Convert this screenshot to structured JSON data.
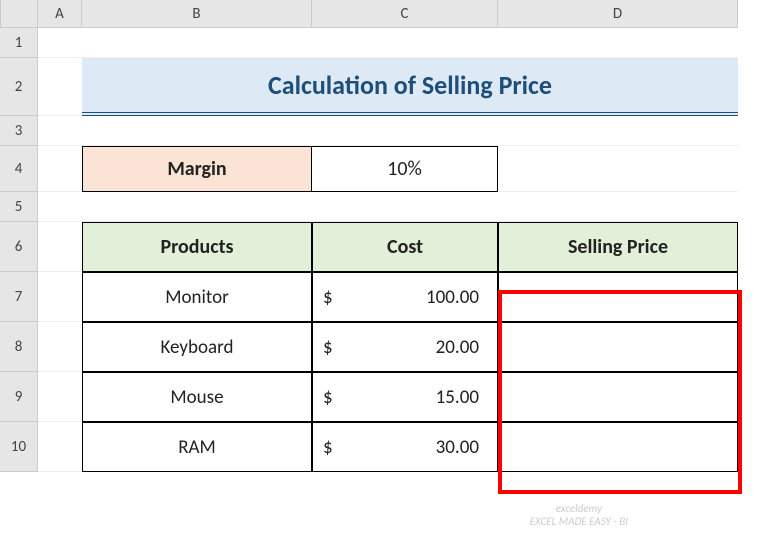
{
  "columns": [
    "A",
    "B",
    "C",
    "D"
  ],
  "rows": [
    "1",
    "2",
    "3",
    "4",
    "5",
    "6",
    "7",
    "8",
    "9",
    "10"
  ],
  "title": "Calculation of Selling Price",
  "margin": {
    "label": "Margin",
    "value": "10%"
  },
  "tableHeaders": {
    "products": "Products",
    "cost": "Cost",
    "selling": "Selling Price"
  },
  "items": [
    {
      "product": "Monitor",
      "cost": "100.00",
      "selling": ""
    },
    {
      "product": "Keyboard",
      "cost": "20.00",
      "selling": ""
    },
    {
      "product": "Mouse",
      "cost": "15.00",
      "selling": ""
    },
    {
      "product": "RAM",
      "cost": "30.00",
      "selling": ""
    }
  ],
  "currency": "$",
  "watermark": {
    "line1": "exceldemy",
    "line2": "EXCEL MADE EASY - BI"
  }
}
